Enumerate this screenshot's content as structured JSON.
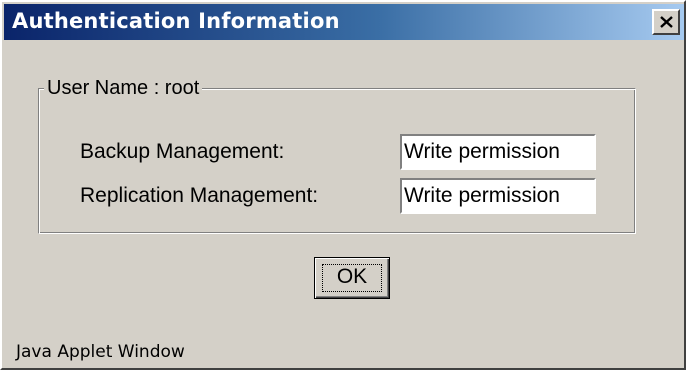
{
  "window": {
    "title": "Authentication Information",
    "close_symbol": "×"
  },
  "group": {
    "legend": "User Name : root",
    "rows": [
      {
        "label": "Backup Management:",
        "value": "Write permission"
      },
      {
        "label": "Replication Management:",
        "value": "Write permission"
      }
    ]
  },
  "buttons": {
    "ok_label": "OK"
  },
  "status": {
    "text": "Java Applet Window"
  },
  "colors": {
    "titlebar_start": "#0a246a",
    "titlebar_end": "#a6caf0",
    "face": "#d4d0c8"
  },
  "icons": {
    "close": "close-icon"
  }
}
